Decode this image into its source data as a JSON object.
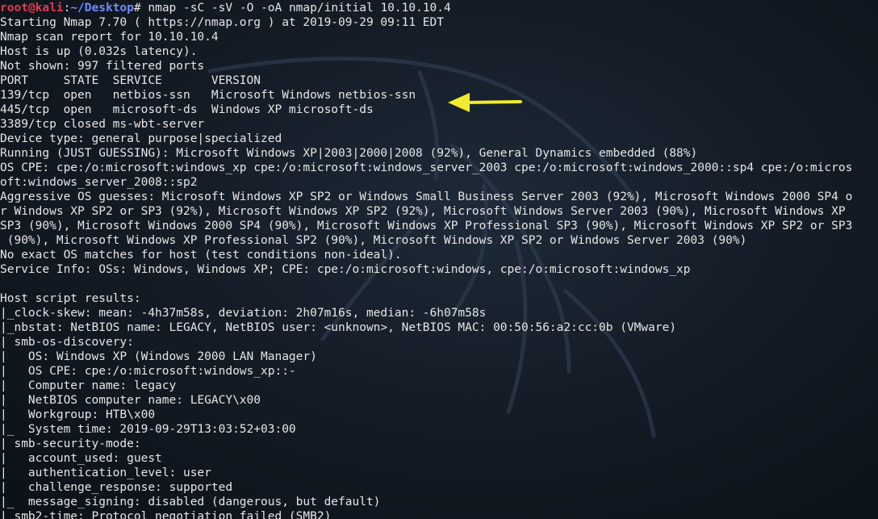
{
  "prompt": {
    "user": "root@kali",
    "path": "~/Desktop",
    "symbol": "#",
    "command": "nmap -sC -sV -O -oA nmap/initial 10.10.10.4"
  },
  "output_lines": [
    "Starting Nmap 7.70 ( https://nmap.org ) at 2019-09-29 09:11 EDT",
    "Nmap scan report for 10.10.10.4",
    "Host is up (0.032s latency).",
    "Not shown: 997 filtered ports",
    "PORT     STATE  SERVICE       VERSION",
    "139/tcp  open   netbios-ssn   Microsoft Windows netbios-ssn",
    "445/tcp  open   microsoft-ds  Windows XP microsoft-ds",
    "3389/tcp closed ms-wbt-server",
    "Device type: general purpose|specialized",
    "Running (JUST GUESSING): Microsoft Windows XP|2003|2000|2008 (92%), General Dynamics embedded (88%)",
    "OS CPE: cpe:/o:microsoft:windows_xp cpe:/o:microsoft:windows_server_2003 cpe:/o:microsoft:windows_2000::sp4 cpe:/o:micros",
    "oft:windows_server_2008::sp2",
    "Aggressive OS guesses: Microsoft Windows XP SP2 or Windows Small Business Server 2003 (92%), Microsoft Windows 2000 SP4 o",
    "r Windows XP SP2 or SP3 (92%), Microsoft Windows XP SP2 (92%), Microsoft Windows Server 2003 (90%), Microsoft Windows XP",
    "SP3 (90%), Microsoft Windows 2000 SP4 (90%), Microsoft Windows XP Professional SP3 (90%), Microsoft Windows XP SP2 or SP3",
    " (90%), Microsoft Windows XP Professional SP2 (90%), Microsoft Windows XP SP2 or Windows Server 2003 (90%)",
    "No exact OS matches for host (test conditions non-ideal).",
    "Service Info: OSs: Windows, Windows XP; CPE: cpe:/o:microsoft:windows, cpe:/o:microsoft:windows_xp",
    "",
    "Host script results:",
    "|_clock-skew: mean: -4h37m58s, deviation: 2h07m16s, median: -6h07m58s",
    "|_nbstat: NetBIOS name: LEGACY, NetBIOS user: <unknown>, NetBIOS MAC: 00:50:56:a2:cc:0b (VMware)",
    "| smb-os-discovery:",
    "|   OS: Windows XP (Windows 2000 LAN Manager)",
    "|   OS CPE: cpe:/o:microsoft:windows_xp::-",
    "|   Computer name: legacy",
    "|   NetBIOS computer name: LEGACY\\x00",
    "|   Workgroup: HTB\\x00",
    "|_  System time: 2019-09-29T13:03:52+03:00",
    "| smb-security-mode:",
    "|   account_used: guest",
    "|   authentication_level: user",
    "|   challenge_response: supported",
    "|_  message_signing: disabled (dangerous, but default)",
    "|_smb2-time: Protocol negotiation failed (SMB2)"
  ],
  "colors": {
    "background": "#141c26",
    "text": "#e6e6e6",
    "prompt_user": "#e8384f",
    "prompt_path": "#6d8ef8",
    "arrow": "#f2ea2e"
  },
  "icons": {
    "annotation": "yellow-arrow-icon",
    "background": "kali-dragon-logo-icon"
  }
}
